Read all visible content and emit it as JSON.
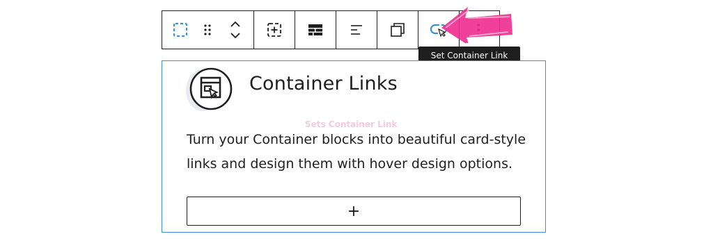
{
  "toolbar": {
    "buttons": [
      {
        "name": "select-container-icon"
      },
      {
        "name": "drag-handle-icon"
      },
      {
        "name": "move-up-down-icon"
      },
      {
        "name": "add-block-icon"
      },
      {
        "name": "layout-grid-icon"
      },
      {
        "name": "align-icon"
      },
      {
        "name": "duplicate-icon"
      },
      {
        "name": "link-icon"
      },
      {
        "name": "more-options-icon"
      }
    ],
    "tooltip": "Set Container Link"
  },
  "block": {
    "title": "Container Links",
    "ghost_label": "Sets Container Link",
    "description_line1": "Turn your Container blocks into beautiful card-style",
    "description_line2": "links and design them with hover design options.",
    "appender_label": "+"
  },
  "colors": {
    "accent_blue": "#3a8fd6",
    "annotation_pink": "#ee2b8e",
    "tooltip_bg": "#1e1e1e"
  }
}
